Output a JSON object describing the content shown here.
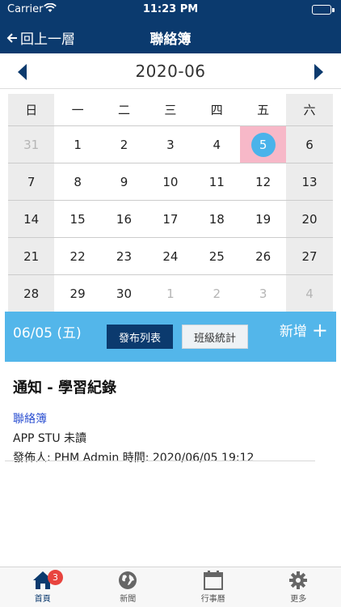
{
  "status": {
    "carrier": "Carrier",
    "time": "11:23 PM"
  },
  "nav": {
    "back_label": "回上一層",
    "title": "聯絡簿"
  },
  "calendar": {
    "month_label": "2020-06",
    "weekdays": [
      "日",
      "一",
      "二",
      "三",
      "四",
      "五",
      "六"
    ],
    "weeks": [
      [
        "31",
        "1",
        "2",
        "3",
        "4",
        "5",
        "6"
      ],
      [
        "7",
        "8",
        "9",
        "10",
        "11",
        "12",
        "13"
      ],
      [
        "14",
        "15",
        "16",
        "17",
        "18",
        "19",
        "20"
      ],
      [
        "21",
        "22",
        "23",
        "24",
        "25",
        "26",
        "27"
      ],
      [
        "28",
        "29",
        "30",
        "1",
        "2",
        "3",
        "4"
      ]
    ],
    "selected_day": "5"
  },
  "daybar": {
    "date": "06/05 (五)",
    "publish_list": "發布列表",
    "class_stats": "班級統計",
    "add_label": "新增",
    "add_symbol": "+"
  },
  "notice": {
    "title": "通知 - 學習紀錄",
    "category": "聯絡簿",
    "read_status": "APP STU 未讀",
    "publisher_line": "發佈人: PHM Admin 時間: 2020/06/05 19:12"
  },
  "tabbar": {
    "tabs": [
      {
        "label": "首頁",
        "icon": "home-icon",
        "badge": "3"
      },
      {
        "label": "新聞",
        "icon": "globe-icon"
      },
      {
        "label": "行事曆",
        "icon": "calendar-icon"
      },
      {
        "label": "更多",
        "icon": "gear-icon"
      }
    ]
  },
  "colors": {
    "nav": "#0b3a6e",
    "accent": "#53b6ea",
    "today_bg": "#f7b8c8",
    "today_dot": "#4ab3ea",
    "badge": "#e8443f"
  }
}
